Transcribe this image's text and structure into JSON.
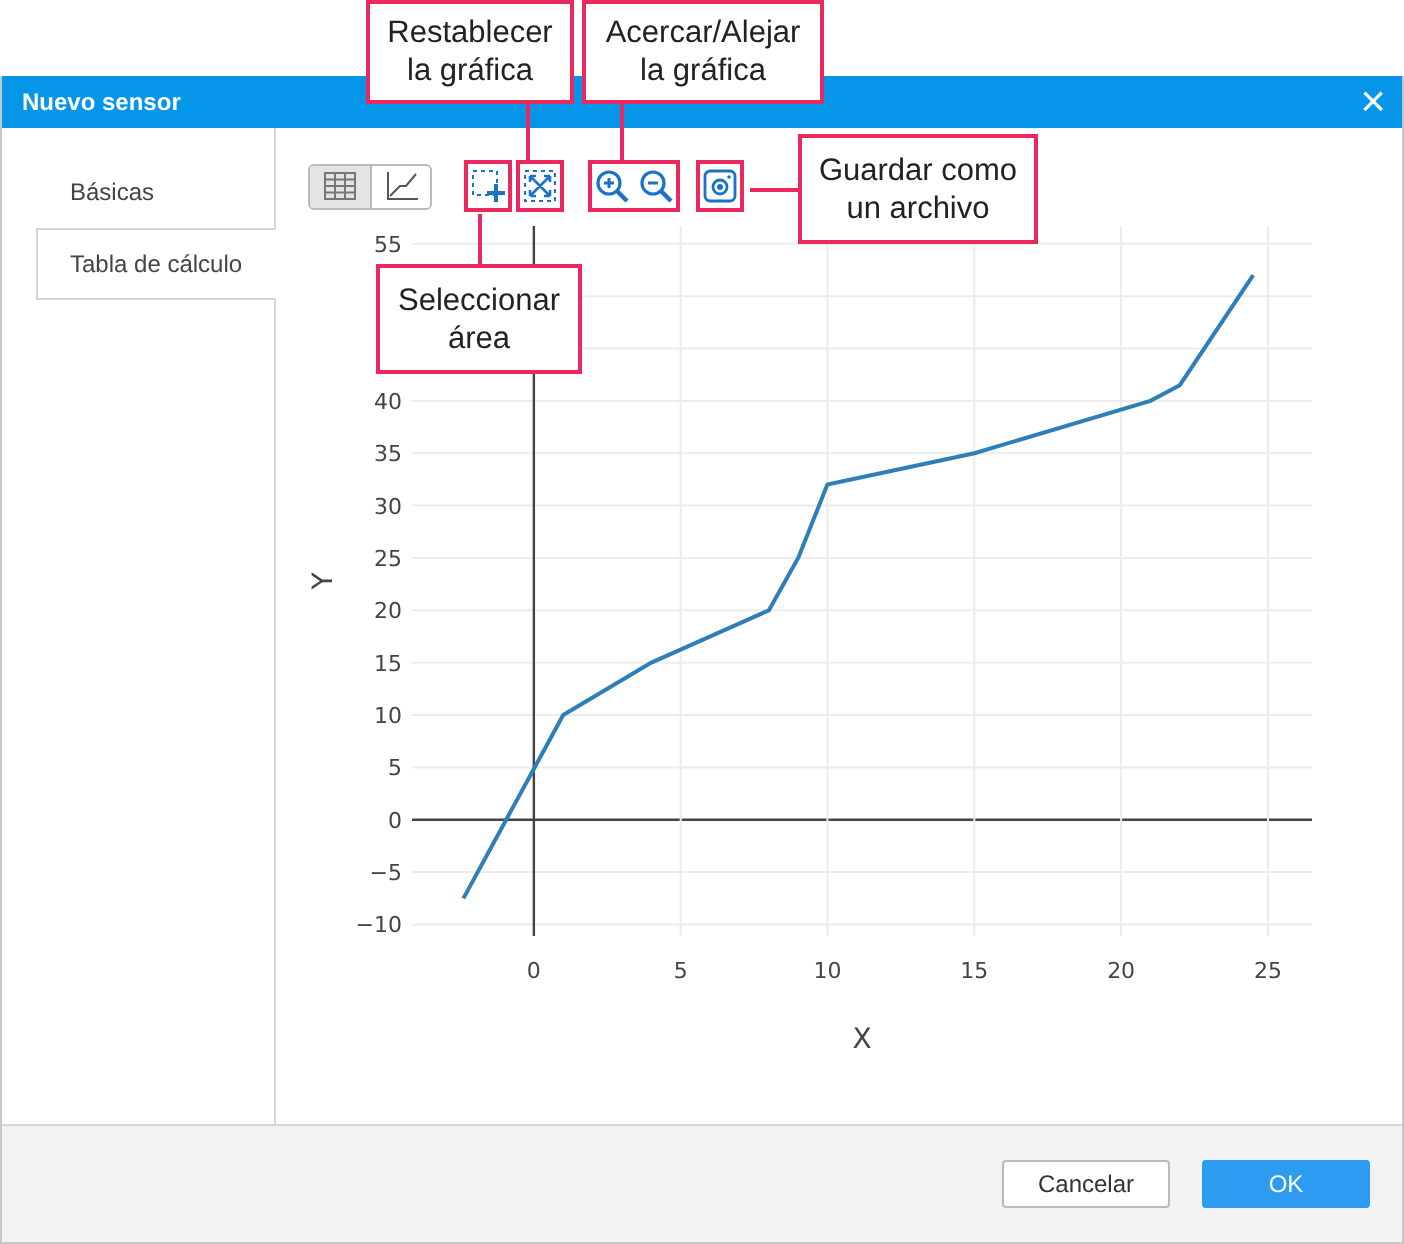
{
  "window": {
    "title": "Nuevo sensor",
    "close": "×"
  },
  "tabs": [
    {
      "label": "Básicas",
      "selected": false
    },
    {
      "label": "Tabla de cálculo",
      "selected": true
    }
  ],
  "view_toggle": [
    {
      "kind": "table",
      "selected": true
    },
    {
      "kind": "chart",
      "selected": false
    }
  ],
  "chart_tools": [
    {
      "kind": "select-area"
    },
    {
      "kind": "reset"
    },
    {
      "kind": "zoom-in"
    },
    {
      "kind": "zoom-out"
    },
    {
      "kind": "save"
    }
  ],
  "chart": {
    "chart_data": {
      "type": "line",
      "xlabel": "X",
      "ylabel": "Y",
      "xlim": [
        -4.15,
        26.5
      ],
      "ylim": [
        -11.1,
        56.7
      ],
      "xticks": [
        0,
        5,
        10,
        15,
        20,
        25
      ],
      "yticks": [
        {
          "value": -10,
          "label": "−10"
        },
        {
          "value": -5,
          "label": "−5"
        },
        0,
        5,
        10,
        15,
        20,
        25,
        30,
        35,
        40,
        55
      ],
      "grid": true,
      "x": [
        -2.4,
        1,
        4,
        8,
        9,
        10,
        15,
        21,
        22,
        24.5
      ],
      "series": [
        {
          "color": "#2e7eb8",
          "values": [
            -7.5,
            10,
            15,
            20,
            25,
            32,
            35,
            40,
            41.5,
            52
          ]
        }
      ]
    }
  },
  "callouts": [
    {
      "text": "Restablecer\nla gráfica"
    },
    {
      "text": "Acercar/Alejar\nla gráfica"
    },
    {
      "text": "Guardar como\nun archivo"
    },
    {
      "text": "Seleccionar\nárea"
    }
  ],
  "buttons": [
    {
      "label": "Cancelar",
      "kind": "secondary"
    },
    {
      "label": "OK",
      "kind": "primary"
    }
  ]
}
